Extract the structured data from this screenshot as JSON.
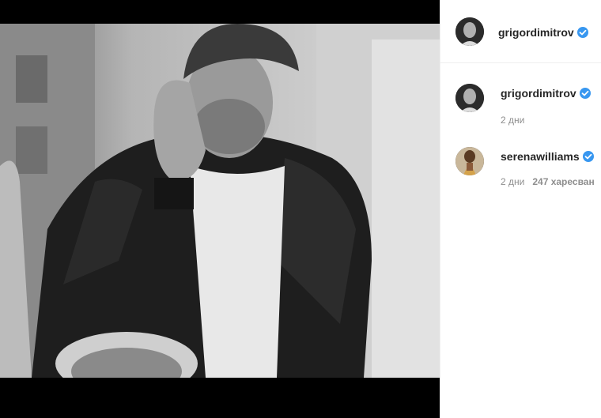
{
  "post": {
    "author": "grigordimitrov",
    "author_verified": true,
    "photo_alt_icon": "portrait-photo"
  },
  "comments": [
    {
      "username": "grigordimitrov",
      "verified": true,
      "time": "2 дни",
      "likes": ""
    },
    {
      "username": "serenawilliams",
      "verified": true,
      "time": "2 дни",
      "likes": "247 харесван"
    }
  ],
  "colors": {
    "verified": "#3897f0",
    "text": "#262626",
    "muted": "#8e8e8e"
  }
}
